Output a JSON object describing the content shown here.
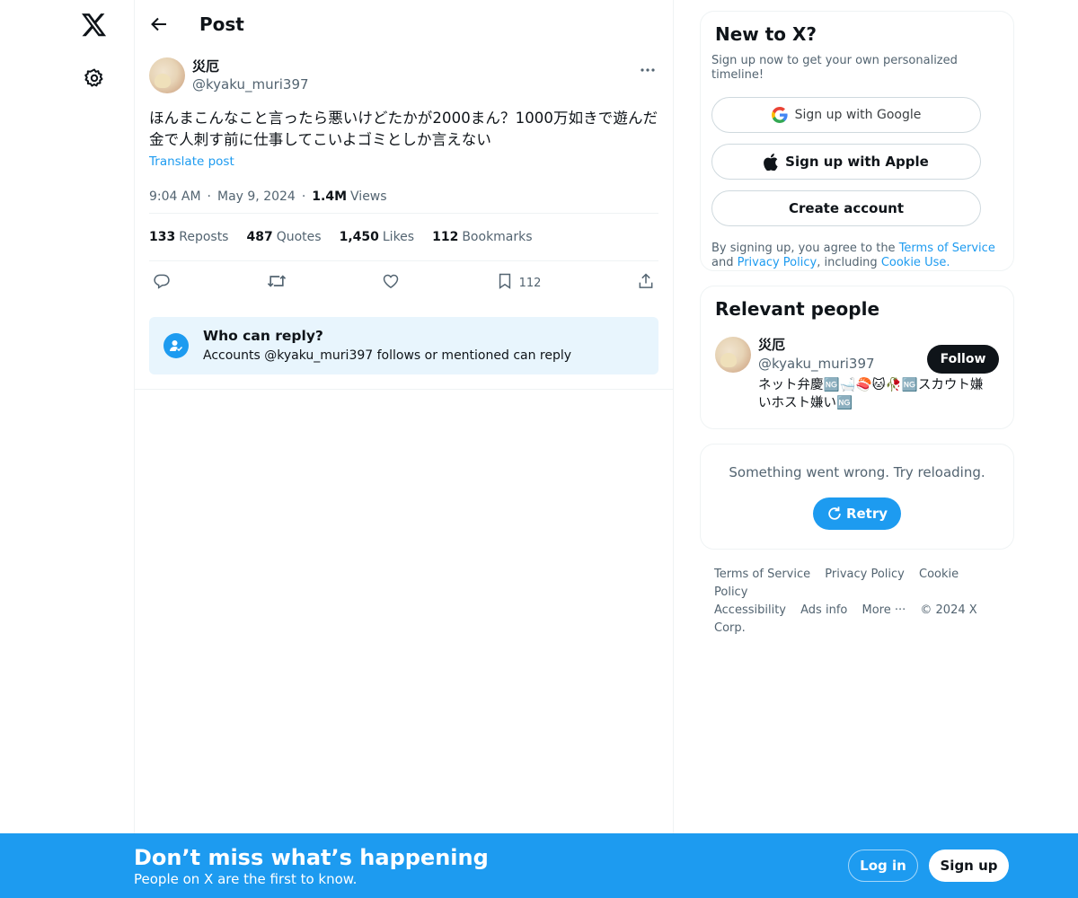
{
  "header": {
    "title": "Post"
  },
  "post": {
    "author": {
      "display_name": "災厄",
      "handle": "@kyaku_muri397"
    },
    "text": "ほんまこんなこと言ったら悪いけどたかが2000まん？1000万如きで遊んだ金で人刺す前に仕事してこいよゴミとしか言えない",
    "translate_label": "Translate post",
    "time": "9:04 AM",
    "date": "May 9, 2024",
    "views_count": "1.4M",
    "views_label": "Views",
    "stats": [
      {
        "count": "133",
        "label": "Reposts"
      },
      {
        "count": "487",
        "label": "Quotes"
      },
      {
        "count": "1,450",
        "label": "Likes"
      },
      {
        "count": "112",
        "label": "Bookmarks"
      }
    ],
    "actions": {
      "bookmark_count": "112"
    },
    "reply_restriction": {
      "title": "Who can reply?",
      "subtitle": "Accounts @kyaku_muri397 follows or mentioned can reply"
    }
  },
  "signup_card": {
    "title": "New to X?",
    "subtitle": "Sign up now to get your own personalized timeline!",
    "google_label": "Sign up with Google",
    "apple_label": "Sign up with Apple",
    "create_label": "Create account",
    "legal_prefix": "By signing up, you agree to the ",
    "terms_link": "Terms of Service",
    "legal_and": " and ",
    "privacy_link": "Privacy Policy",
    "legal_including": ", including ",
    "cookie_link": "Cookie Use."
  },
  "relevant_people": {
    "title": "Relevant people",
    "person": {
      "display_name": "災厄",
      "handle": "@kyaku_muri397",
      "bio": "ネット弁慶🆖🛁🍣🐱🥀🆖スカウト嫌いホスト嫌い🆖"
    },
    "follow_label": "Follow"
  },
  "error_card": {
    "message": "Something went wrong. Try reloading.",
    "retry_label": "Retry"
  },
  "footer": {
    "links": [
      "Terms of Service",
      "Privacy Policy",
      "Cookie Policy",
      "Accessibility",
      "Ads info",
      "More ···"
    ],
    "copyright": "© 2024 X Corp."
  },
  "bottom_bar": {
    "title": "Don’t miss what’s happening",
    "subtitle": "People on X are the first to know.",
    "login_label": "Log in",
    "signup_label": "Sign up"
  },
  "colors": {
    "accent": "#1d9bf0",
    "text": "#0f1419",
    "muted": "#536471",
    "border": "#eff3f4"
  },
  "icons": [
    "x-logo-icon",
    "settings-icon",
    "back-arrow-icon",
    "more-icon",
    "reply-icon",
    "repost-icon",
    "like-icon",
    "bookmark-icon",
    "share-icon",
    "google-icon",
    "apple-icon",
    "retry-icon",
    "person-check-icon"
  ]
}
